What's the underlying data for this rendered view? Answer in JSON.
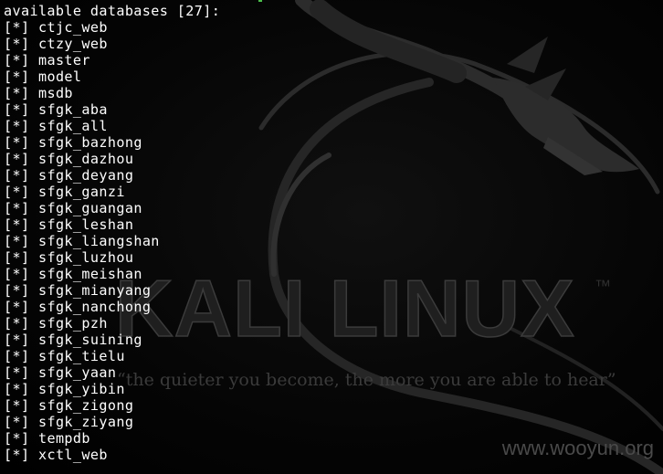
{
  "terminal": {
    "header": "available databases [27]:",
    "prefix": "[*]",
    "databases": [
      "ctjc_web",
      "ctzy_web",
      "master",
      "model",
      "msdb",
      "sfgk_aba",
      "sfgk_all",
      "sfgk_bazhong",
      "sfgk_dazhou",
      "sfgk_deyang",
      "sfgk_ganzi",
      "sfgk_guangan",
      "sfgk_leshan",
      "sfgk_liangshan",
      "sfgk_luzhou",
      "sfgk_meishan",
      "sfgk_mianyang",
      "sfgk_nanchong",
      "sfgk_pzh",
      "sfgk_suining",
      "sfgk_tielu",
      "sfgk_yaan",
      "sfgk_yibin",
      "sfgk_zigong",
      "sfgk_ziyang",
      "tempdb",
      "xctl_web"
    ]
  },
  "wallpaper": {
    "logo_text": "KALI LINUX",
    "trademark": "™",
    "quote": "“the quieter you become, the more you are able to hear”"
  },
  "watermark": {
    "site": "www.wooyun.org"
  },
  "colors": {
    "background": "#000000",
    "text": "#ffffff",
    "dragon": "#2a2a2a",
    "watermark": "#4a4a4a",
    "cursor_accent": "#4cbf4c"
  },
  "icons": {
    "wallpaper_logo": "kali-dragon-icon"
  }
}
